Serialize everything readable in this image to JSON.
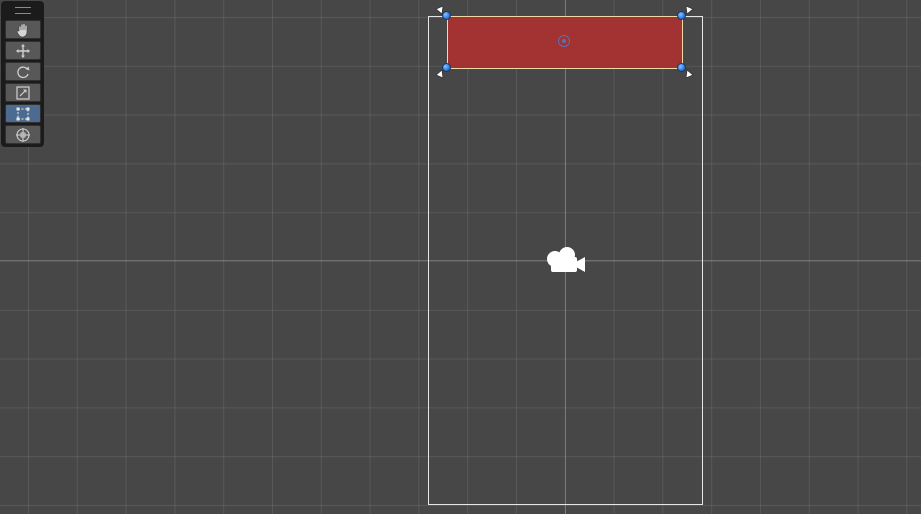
{
  "app": {
    "view": "Scene"
  },
  "toolbar": {
    "tools": [
      {
        "name": "hand-tool",
        "icon": "hand-icon",
        "active": false
      },
      {
        "name": "move-tool",
        "icon": "move-arrows-icon",
        "active": false
      },
      {
        "name": "rotate-tool",
        "icon": "rotate-icon",
        "active": false
      },
      {
        "name": "scale-tool",
        "icon": "scale-icon",
        "active": false
      },
      {
        "name": "rect-tool",
        "icon": "rect-transform-icon",
        "active": true
      },
      {
        "name": "transform-tool",
        "icon": "transform-gizmo-icon",
        "active": false
      }
    ],
    "active_color": "#4d6a91"
  },
  "scene": {
    "background_color": "#474747",
    "grid": true,
    "camera_icon": "camera-gizmo-icon",
    "selected_object": {
      "fill_color": "#a33232",
      "handle_color": "#2f78d8",
      "pivot_icon": "pivot-icon",
      "anchor_icon": "anchor-triangle-icon"
    },
    "camera_frame_color": "#e6e6e6"
  }
}
